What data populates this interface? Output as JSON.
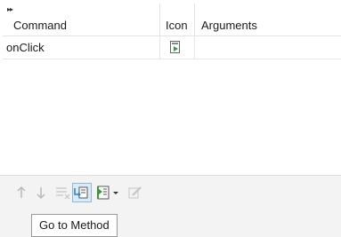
{
  "table": {
    "columns": {
      "command": "Command",
      "icon": "Icon",
      "arguments": "Arguments"
    },
    "rows": [
      {
        "command": "onClick",
        "icon": "run-method-icon",
        "arguments": ""
      }
    ]
  },
  "toolbar": {
    "buttons": [
      {
        "name": "move-up",
        "icon": "arrow-up-icon",
        "enabled": false
      },
      {
        "name": "move-down",
        "icon": "arrow-down-icon",
        "enabled": false
      },
      {
        "name": "delete",
        "icon": "delete-list-icon",
        "enabled": false
      },
      {
        "name": "go-to-method",
        "icon": "go-to-method-icon",
        "enabled": true,
        "hovered": true
      },
      {
        "name": "add-method",
        "icon": "add-method-icon",
        "enabled": true
      },
      {
        "name": "add-method-dropdown",
        "icon": "chevron-down-icon",
        "enabled": true
      },
      {
        "name": "edit",
        "icon": "edit-icon",
        "enabled": false
      }
    ]
  },
  "tooltip": {
    "text": "Go to Method"
  },
  "colors": {
    "accent_green": "#3a9a3a",
    "hover_fill": "#dbeaf8",
    "hover_border": "#8fb8df",
    "toolbar_bg": "#f3f3f3",
    "disabled": "#b8b8b8"
  }
}
